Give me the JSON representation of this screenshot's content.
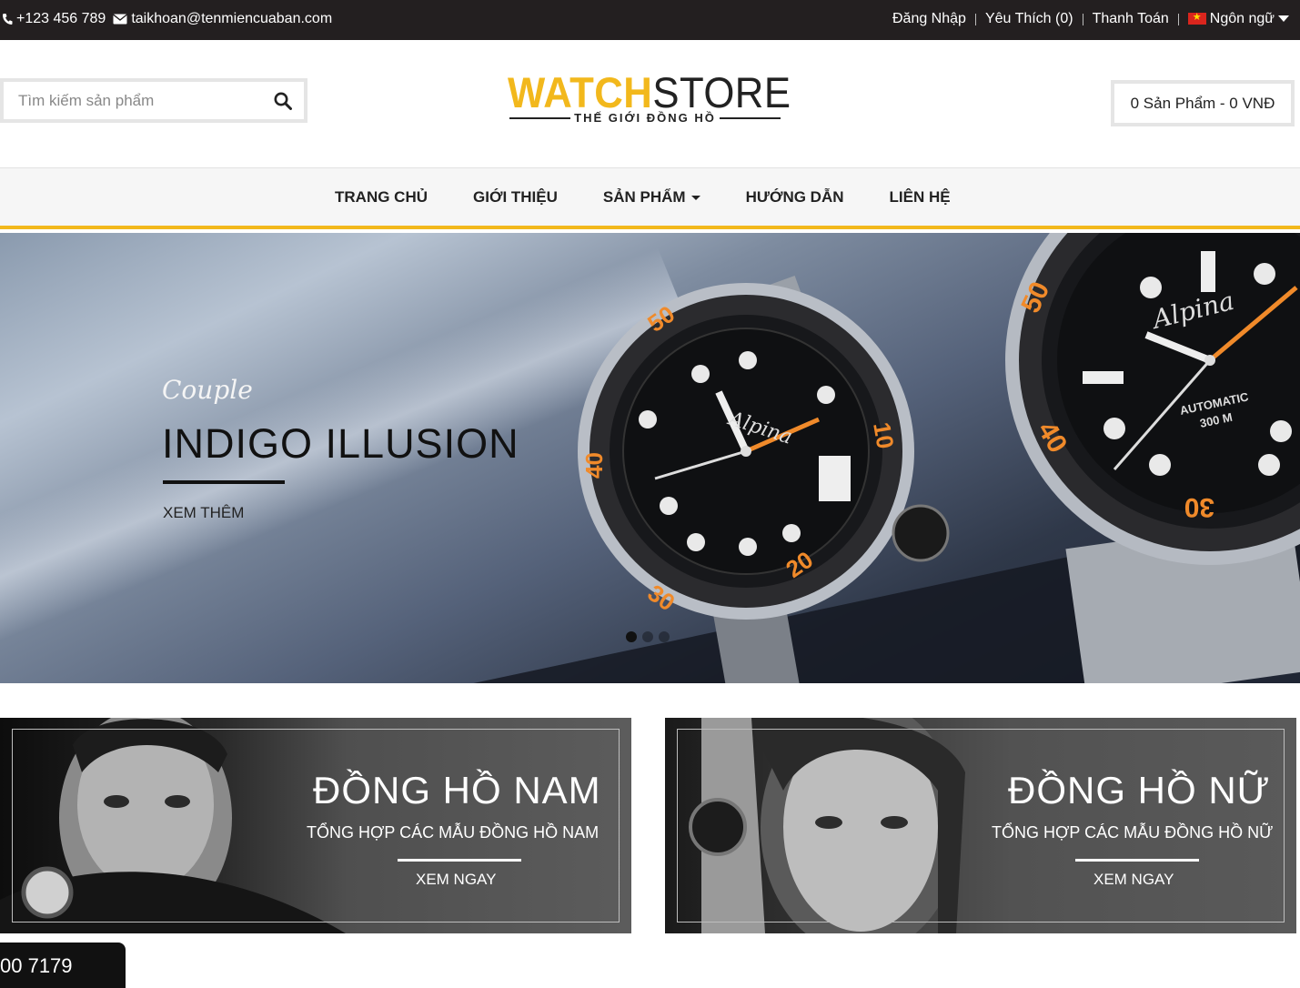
{
  "topbar": {
    "phone": "+123 456 789",
    "email": "taikhoan@tenmiencuaban.com",
    "login": "Đăng Nhập",
    "wishlist": "Yêu Thích (0)",
    "checkout": "Thanh Toán",
    "language": "Ngôn ngữ"
  },
  "header": {
    "search_placeholder": "Tìm kiếm sản phẩm",
    "logo_part1": "WATCH",
    "logo_part2": "STORE",
    "logo_tagline": "THẾ GIỚI ĐỒNG HỒ",
    "cart": "0 Sản Phẩm - 0 VNĐ"
  },
  "nav": {
    "items": [
      {
        "label": "TRANG CHỦ"
      },
      {
        "label": "GIỚI THIỆU"
      },
      {
        "label": "SẢN PHẨM"
      },
      {
        "label": "HƯỚNG DẪN"
      },
      {
        "label": "LIÊN HỆ"
      }
    ]
  },
  "hero": {
    "script": "Couple",
    "title": "INDIGO ILLUSION",
    "more": "XEM THÊM",
    "watch_brand": "Alpina",
    "watch_text": "AUTOMATIC 300 M",
    "slides": 3,
    "active_slide": 1
  },
  "banners": [
    {
      "title": "ĐỒNG HỒ NAM",
      "subtitle": "TỔNG HỢP CÁC MẪU ĐỒNG HỒ NAM",
      "cta": "XEM NGAY"
    },
    {
      "title": "ĐỒNG HỒ NỮ",
      "subtitle": "TỔNG HỢP CÁC MẪU ĐỒNG HỒ NỮ",
      "cta": "XEM NGAY"
    }
  ],
  "hotline": "00 7179",
  "colors": {
    "accent": "#f2b81c",
    "topbar": "#231f20"
  }
}
